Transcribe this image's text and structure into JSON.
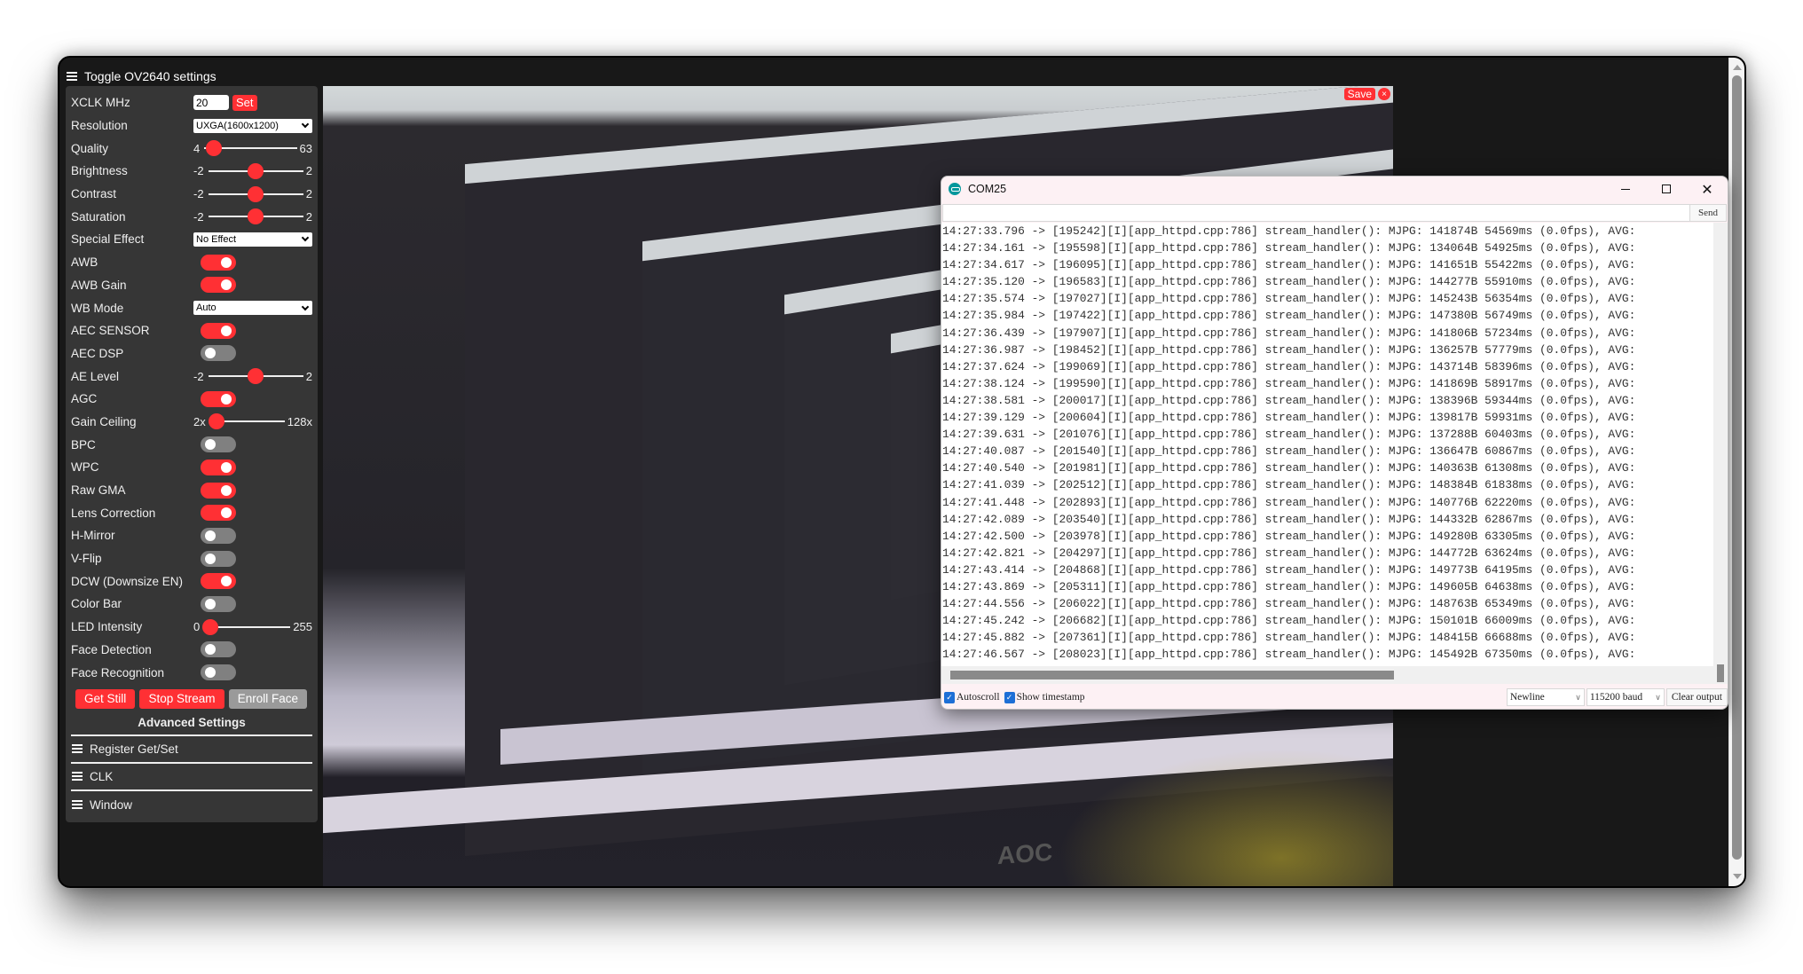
{
  "header": {
    "toggle_label": "Toggle OV2640 settings"
  },
  "settings": {
    "xclk": {
      "label": "XCLK MHz",
      "value": "20",
      "set_label": "Set"
    },
    "resolution": {
      "label": "Resolution",
      "value": "UXGA(1600x1200)"
    },
    "sliders": {
      "quality": {
        "label": "Quality",
        "min": "4",
        "max": "63",
        "value": 10,
        "range": [
          4,
          63
        ]
      },
      "brightness": {
        "label": "Brightness",
        "min": "-2",
        "max": "2",
        "value": 0,
        "range": [
          -2,
          2
        ]
      },
      "contrast": {
        "label": "Contrast",
        "min": "-2",
        "max": "2",
        "value": 0,
        "range": [
          -2,
          2
        ]
      },
      "saturation": {
        "label": "Saturation",
        "min": "-2",
        "max": "2",
        "value": 0,
        "range": [
          -2,
          2
        ]
      },
      "ae_level": {
        "label": "AE Level",
        "min": "-2",
        "max": "2",
        "value": 0,
        "range": [
          -2,
          2
        ]
      },
      "gain_ceiling": {
        "label": "Gain Ceiling",
        "min": "2x",
        "max": "128x",
        "value": 0,
        "range": [
          0,
          6
        ]
      },
      "led_intensity": {
        "label": "LED Intensity",
        "min": "0",
        "max": "255",
        "value": 0,
        "range": [
          0,
          255
        ]
      }
    },
    "special_effect": {
      "label": "Special Effect",
      "value": "No Effect"
    },
    "wb_mode": {
      "label": "WB Mode",
      "value": "Auto"
    },
    "toggles": {
      "awb": {
        "label": "AWB",
        "on": true
      },
      "awb_gain": {
        "label": "AWB Gain",
        "on": true
      },
      "aec_sensor": {
        "label": "AEC SENSOR",
        "on": true
      },
      "aec_dsp": {
        "label": "AEC DSP",
        "on": false
      },
      "agc": {
        "label": "AGC",
        "on": true
      },
      "bpc": {
        "label": "BPC",
        "on": false
      },
      "wpc": {
        "label": "WPC",
        "on": true
      },
      "raw_gma": {
        "label": "Raw GMA",
        "on": true
      },
      "lens_correction": {
        "label": "Lens Correction",
        "on": true
      },
      "h_mirror": {
        "label": "H-Mirror",
        "on": false
      },
      "v_flip": {
        "label": "V-Flip",
        "on": false
      },
      "dcw": {
        "label": "DCW (Downsize EN)",
        "on": true
      },
      "color_bar": {
        "label": "Color Bar",
        "on": false
      },
      "face_detection": {
        "label": "Face Detection",
        "on": false
      },
      "face_recognition": {
        "label": "Face Recognition",
        "on": false
      }
    },
    "buttons": {
      "get_still": "Get Still",
      "stop_stream": "Stop Stream",
      "enroll_face": "Enroll Face"
    },
    "advanced": {
      "title": "Advanced Settings",
      "items": [
        "Register Get/Set",
        "CLK",
        "Window"
      ]
    }
  },
  "video": {
    "save_label": "Save",
    "close_label": "×",
    "brand_text": "AOC"
  },
  "serial": {
    "title": "COM25",
    "input_value": "",
    "send_label": "Send",
    "lines": [
      "14:27:33.796 -> [195242][I][app_httpd.cpp:786] stream_handler(): MJPG: 141874B 54569ms (0.0fps), AVG: ",
      "14:27:34.161 -> [195598][I][app_httpd.cpp:786] stream_handler(): MJPG: 134064B 54925ms (0.0fps), AVG: ",
      "14:27:34.617 -> [196095][I][app_httpd.cpp:786] stream_handler(): MJPG: 141651B 55422ms (0.0fps), AVG: ",
      "14:27:35.120 -> [196583][I][app_httpd.cpp:786] stream_handler(): MJPG: 144277B 55910ms (0.0fps), AVG: ",
      "14:27:35.574 -> [197027][I][app_httpd.cpp:786] stream_handler(): MJPG: 145243B 56354ms (0.0fps), AVG: ",
      "14:27:35.984 -> [197422][I][app_httpd.cpp:786] stream_handler(): MJPG: 147380B 56749ms (0.0fps), AVG: ",
      "14:27:36.439 -> [197907][I][app_httpd.cpp:786] stream_handler(): MJPG: 141806B 57234ms (0.0fps), AVG: ",
      "14:27:36.987 -> [198452][I][app_httpd.cpp:786] stream_handler(): MJPG: 136257B 57779ms (0.0fps), AVG: ",
      "14:27:37.624 -> [199069][I][app_httpd.cpp:786] stream_handler(): MJPG: 143714B 58396ms (0.0fps), AVG: ",
      "14:27:38.124 -> [199590][I][app_httpd.cpp:786] stream_handler(): MJPG: 141869B 58917ms (0.0fps), AVG: ",
      "14:27:38.581 -> [200017][I][app_httpd.cpp:786] stream_handler(): MJPG: 138396B 59344ms (0.0fps), AVG: ",
      "14:27:39.129 -> [200604][I][app_httpd.cpp:786] stream_handler(): MJPG: 139817B 59931ms (0.0fps), AVG: ",
      "14:27:39.631 -> [201076][I][app_httpd.cpp:786] stream_handler(): MJPG: 137288B 60403ms (0.0fps), AVG: ",
      "14:27:40.087 -> [201540][I][app_httpd.cpp:786] stream_handler(): MJPG: 136647B 60867ms (0.0fps), AVG: ",
      "14:27:40.540 -> [201981][I][app_httpd.cpp:786] stream_handler(): MJPG: 140363B 61308ms (0.0fps), AVG: ",
      "14:27:41.039 -> [202512][I][app_httpd.cpp:786] stream_handler(): MJPG: 148384B 61838ms (0.0fps), AVG: ",
      "14:27:41.448 -> [202893][I][app_httpd.cpp:786] stream_handler(): MJPG: 140776B 62220ms (0.0fps), AVG: ",
      "14:27:42.089 -> [203540][I][app_httpd.cpp:786] stream_handler(): MJPG: 144332B 62867ms (0.0fps), AVG: ",
      "14:27:42.500 -> [203978][I][app_httpd.cpp:786] stream_handler(): MJPG: 149280B 63305ms (0.0fps), AVG: ",
      "14:27:42.821 -> [204297][I][app_httpd.cpp:786] stream_handler(): MJPG: 144772B 63624ms (0.0fps), AVG: ",
      "14:27:43.414 -> [204868][I][app_httpd.cpp:786] stream_handler(): MJPG: 149773B 64195ms (0.0fps), AVG: ",
      "14:27:43.869 -> [205311][I][app_httpd.cpp:786] stream_handler(): MJPG: 149605B 64638ms (0.0fps), AVG: ",
      "14:27:44.556 -> [206022][I][app_httpd.cpp:786] stream_handler(): MJPG: 148763B 65349ms (0.0fps), AVG: ",
      "14:27:45.242 -> [206682][I][app_httpd.cpp:786] stream_handler(): MJPG: 150101B 66009ms (0.0fps), AVG: ",
      "14:27:45.882 -> [207361][I][app_httpd.cpp:786] stream_handler(): MJPG: 148415B 66688ms (0.0fps), AVG: ",
      "14:27:46.567 -> [208023][I][app_httpd.cpp:786] stream_handler(): MJPG: 145492B 67350ms (0.0fps), AVG: "
    ],
    "footer": {
      "autoscroll_label": "Autoscroll",
      "autoscroll_checked": true,
      "timestamp_label": "Show timestamp",
      "timestamp_checked": true,
      "line_ending": "Newline",
      "baud": "115200 baud",
      "clear_label": "Clear output"
    }
  },
  "colors": {
    "accent": "#ff3034",
    "panel_bg": "#363636",
    "page_bg": "#181818",
    "toggle_off": "#808080"
  }
}
